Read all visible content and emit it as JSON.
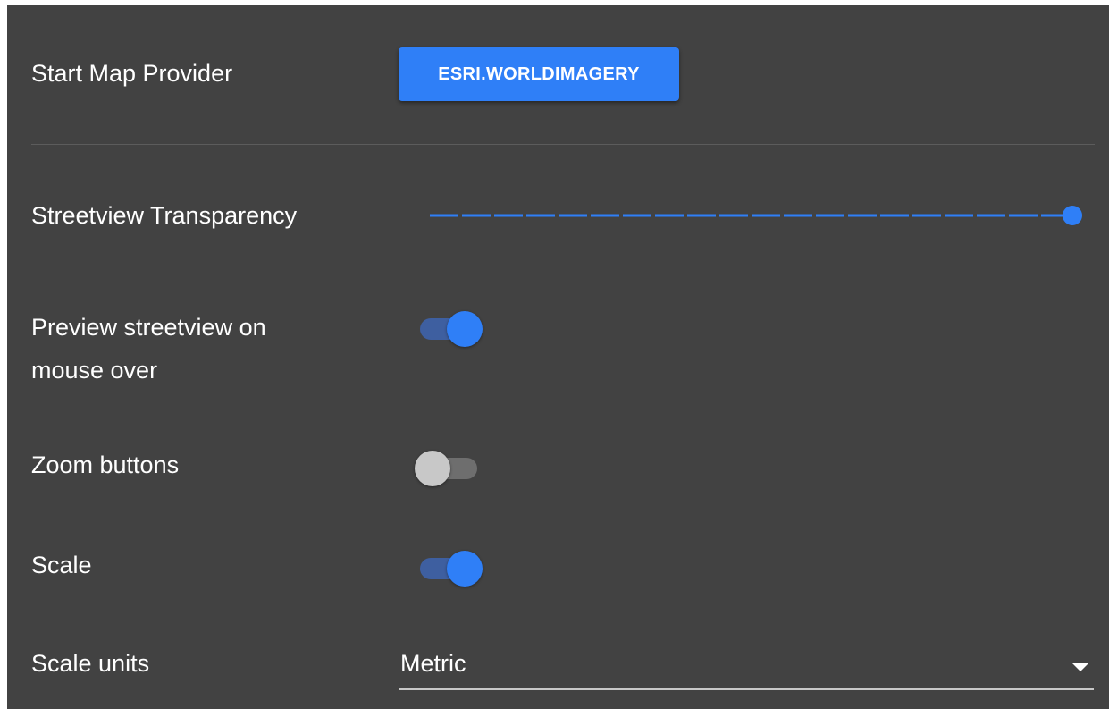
{
  "settings": {
    "start_map_provider": {
      "label": "Start Map Provider",
      "button_label": "ESRI.WORLDIMAGERY"
    },
    "streetview_transparency": {
      "label": "Streetview Transparency",
      "value": 1.0
    },
    "preview_streetview": {
      "label_line1": "Preview streetview on",
      "label_line2": "mouse over",
      "enabled": true
    },
    "zoom_buttons": {
      "label": "Zoom buttons",
      "enabled": false
    },
    "scale": {
      "label": "Scale",
      "enabled": true
    },
    "scale_units": {
      "label": "Scale units",
      "selected": "Metric",
      "icon": "dropdown-caret-icon"
    }
  },
  "colors": {
    "panel_background": "#424242",
    "accent": "#2f7ff7",
    "switch_track_on": "#3e5fa0",
    "switch_track_off": "#6e6e6e",
    "switch_thumb_off": "#c8c8c8"
  }
}
